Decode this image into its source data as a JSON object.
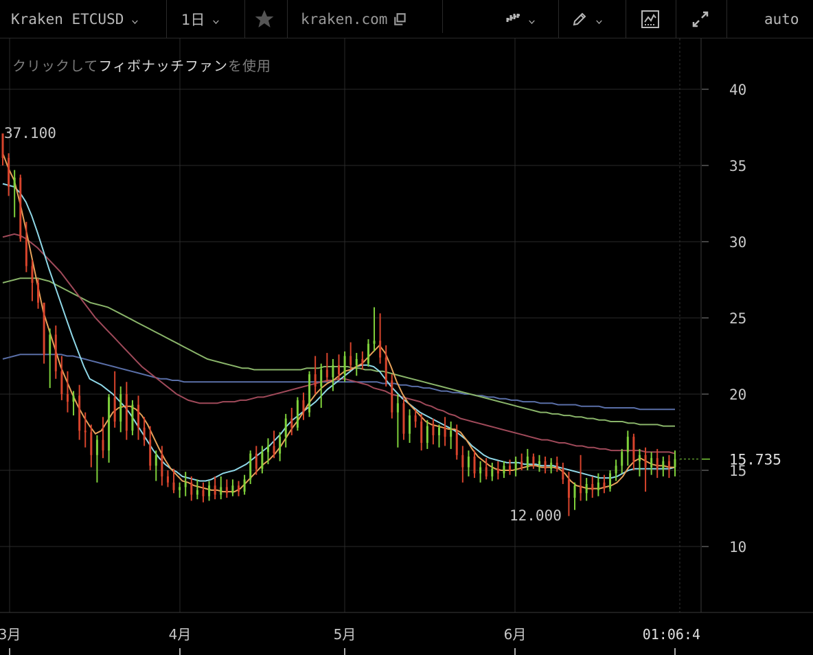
{
  "toolbar": {
    "symbol": "Kraken ETCUSD",
    "interval": "1日",
    "star_icon": "star-icon",
    "domain": "kraken.com",
    "copy_icon": "copy-icon",
    "chart_type_icon": "candlestick-chart-icon",
    "draw_icon": "pencil-icon",
    "indicators_icon": "indicators-icon",
    "fullscreen_icon": "expand-icon",
    "scale_mode": "auto"
  },
  "hint": {
    "prefix": "クリックして",
    "tool": "フィボナッチファン",
    "suffix": "を使用"
  },
  "colors": {
    "up": "#7fd13b",
    "down": "#d8442c",
    "ma_orange": "#e8a25a",
    "ma_cyan": "#8fd8e8",
    "ma_red": "#a04a5a",
    "ma_green": "#8ab56a",
    "ma_blue": "#5a6fa8",
    "grid": "#2a2a2a",
    "axis": "#3a3a3a"
  },
  "chart_data": {
    "type": "candlestick",
    "y_ticks": [
      "40",
      "35",
      "30",
      "25",
      "20",
      "15",
      "10"
    ],
    "ylim": [
      5,
      43
    ],
    "x_ticks": [
      "3月",
      "4月",
      "5月",
      "6月"
    ],
    "last_price": "15.735",
    "high_label": "37.100",
    "low_label": "12.000",
    "time_label": "01:06:4",
    "ohlc": [
      [
        37.1,
        36.2,
        35.0,
        35.5
      ],
      [
        35.5,
        35.8,
        33.0,
        33.6
      ],
      [
        33.6,
        34.7,
        31.6,
        34.2
      ],
      [
        34.2,
        34.4,
        30.0,
        30.2
      ],
      [
        30.2,
        31.3,
        28.0,
        28.4
      ],
      [
        28.4,
        28.8,
        26.1,
        27.3
      ],
      [
        27.3,
        27.6,
        25.6,
        26.0
      ],
      [
        26.0,
        25.8,
        22.0,
        22.6
      ],
      [
        22.6,
        24.3,
        20.4,
        23.9
      ],
      [
        23.9,
        24.5,
        21.0,
        21.5
      ],
      [
        21.5,
        22.5,
        19.6,
        20.0
      ],
      [
        20.0,
        21.5,
        18.8,
        19.5
      ],
      [
        19.5,
        20.2,
        18.6,
        19.9
      ],
      [
        19.9,
        20.6,
        17.0,
        17.6
      ],
      [
        17.6,
        18.8,
        16.5,
        17.5
      ],
      [
        17.5,
        18.0,
        15.2,
        16.0
      ],
      [
        16.0,
        17.3,
        14.2,
        17.0
      ],
      [
        17.0,
        18.5,
        15.8,
        16.3
      ],
      [
        16.3,
        20.0,
        15.5,
        19.8
      ],
      [
        19.8,
        21.5,
        17.8,
        18.2
      ],
      [
        18.2,
        20.5,
        17.5,
        20.0
      ],
      [
        20.0,
        20.8,
        17.0,
        17.6
      ],
      [
        17.6,
        19.6,
        17.3,
        19.3
      ],
      [
        19.3,
        19.9,
        17.0,
        17.8
      ],
      [
        17.8,
        18.5,
        16.6,
        17.0
      ],
      [
        17.0,
        17.9,
        15.0,
        15.3
      ],
      [
        15.3,
        16.3,
        14.3,
        16.0
      ],
      [
        16.0,
        16.6,
        14.0,
        14.6
      ],
      [
        14.6,
        15.0,
        13.9,
        14.2
      ],
      [
        14.2,
        15.1,
        13.5,
        13.7
      ],
      [
        13.7,
        14.2,
        13.2,
        13.9
      ],
      [
        13.9,
        14.9,
        13.3,
        14.2
      ],
      [
        14.2,
        14.6,
        13.0,
        13.4
      ],
      [
        13.4,
        14.4,
        13.1,
        13.7
      ],
      [
        13.7,
        14.2,
        12.9,
        13.3
      ],
      [
        13.3,
        14.3,
        13.0,
        14.0
      ],
      [
        14.0,
        14.6,
        13.1,
        13.4
      ],
      [
        13.4,
        14.6,
        13.1,
        13.9
      ],
      [
        13.9,
        14.4,
        13.2,
        13.5
      ],
      [
        13.5,
        14.4,
        13.3,
        14.0
      ],
      [
        14.0,
        14.3,
        13.3,
        13.6
      ],
      [
        13.6,
        14.7,
        13.4,
        14.4
      ],
      [
        14.4,
        16.3,
        14.1,
        16.1
      ],
      [
        16.1,
        16.6,
        14.7,
        15.1
      ],
      [
        15.1,
        16.6,
        14.8,
        16.2
      ],
      [
        16.2,
        17.1,
        15.4,
        16.6
      ],
      [
        16.6,
        17.6,
        15.8,
        16.1
      ],
      [
        16.1,
        17.5,
        15.6,
        17.2
      ],
      [
        17.2,
        18.7,
        16.5,
        18.4
      ],
      [
        18.4,
        19.1,
        17.3,
        17.8
      ],
      [
        17.8,
        19.8,
        17.6,
        19.6
      ],
      [
        19.6,
        20.1,
        18.3,
        18.8
      ],
      [
        18.8,
        21.5,
        18.5,
        21.3
      ],
      [
        21.3,
        22.5,
        20.0,
        20.5
      ],
      [
        20.5,
        22.0,
        19.1,
        21.6
      ],
      [
        21.6,
        22.7,
        20.8,
        21.1
      ],
      [
        21.1,
        22.3,
        20.2,
        21.9
      ],
      [
        21.9,
        22.6,
        20.9,
        21.3
      ],
      [
        21.3,
        22.8,
        20.8,
        22.5
      ],
      [
        22.5,
        23.4,
        21.6,
        21.9
      ],
      [
        21.9,
        22.7,
        21.2,
        22.3
      ],
      [
        22.3,
        22.8,
        21.6,
        22.0
      ],
      [
        22.0,
        23.6,
        21.8,
        23.3
      ],
      [
        23.3,
        25.7,
        22.8,
        23.5
      ],
      [
        23.5,
        25.3,
        22.0,
        22.4
      ],
      [
        22.4,
        23.2,
        20.5,
        20.9
      ],
      [
        20.9,
        21.3,
        18.4,
        18.8
      ],
      [
        18.8,
        20.0,
        16.5,
        19.4
      ],
      [
        19.4,
        19.7,
        17.0,
        17.4
      ],
      [
        17.4,
        19.0,
        16.8,
        18.6
      ],
      [
        18.6,
        19.0,
        17.8,
        18.2
      ],
      [
        18.2,
        18.7,
        16.3,
        16.8
      ],
      [
        16.8,
        18.3,
        16.4,
        17.9
      ],
      [
        17.9,
        18.4,
        16.7,
        17.3
      ],
      [
        17.3,
        18.0,
        16.5,
        17.8
      ],
      [
        17.8,
        18.5,
        16.6,
        17.2
      ],
      [
        17.2,
        18.2,
        16.4,
        17.6
      ],
      [
        17.6,
        18.0,
        15.7,
        16.0
      ],
      [
        16.0,
        16.6,
        14.2,
        15.2
      ],
      [
        15.2,
        16.3,
        14.6,
        15.9
      ],
      [
        15.9,
        16.3,
        14.5,
        14.8
      ],
      [
        14.8,
        15.6,
        14.2,
        15.2
      ],
      [
        15.2,
        15.8,
        14.4,
        14.6
      ],
      [
        14.6,
        15.5,
        14.3,
        15.1
      ],
      [
        15.1,
        15.6,
        14.4,
        14.8
      ],
      [
        14.8,
        15.6,
        14.5,
        15.3
      ],
      [
        15.3,
        15.7,
        14.7,
        15.0
      ],
      [
        15.0,
        15.9,
        14.6,
        15.6
      ],
      [
        15.6,
        16.1,
        15.0,
        15.2
      ],
      [
        15.2,
        16.4,
        15.0,
        15.9
      ],
      [
        15.9,
        16.1,
        15.1,
        15.4
      ],
      [
        15.4,
        16.0,
        14.9,
        15.6
      ],
      [
        15.6,
        15.9,
        14.8,
        15.1
      ],
      [
        15.1,
        15.8,
        14.8,
        15.5
      ],
      [
        15.5,
        15.9,
        14.9,
        15.1
      ],
      [
        15.1,
        15.5,
        14.1,
        14.4
      ],
      [
        14.4,
        14.9,
        12.0,
        13.2
      ],
      [
        13.2,
        14.2,
        12.4,
        14.0
      ],
      [
        14.0,
        16.0,
        13.0,
        13.5
      ],
      [
        13.5,
        14.5,
        13.0,
        14.1
      ],
      [
        14.1,
        14.6,
        13.2,
        13.7
      ],
      [
        13.7,
        14.8,
        13.3,
        14.2
      ],
      [
        14.2,
        14.7,
        13.5,
        13.8
      ],
      [
        13.8,
        15.0,
        13.6,
        14.8
      ],
      [
        14.8,
        15.7,
        14.3,
        15.3
      ],
      [
        15.3,
        16.4,
        14.8,
        16.2
      ],
      [
        16.2,
        17.6,
        15.3,
        17.2
      ],
      [
        17.2,
        17.4,
        15.0,
        15.6
      ],
      [
        15.6,
        16.4,
        14.6,
        16.0
      ],
      [
        16.0,
        16.5,
        13.6,
        15.2
      ],
      [
        15.2,
        16.2,
        14.7,
        15.8
      ],
      [
        15.8,
        16.4,
        14.5,
        15.1
      ],
      [
        15.1,
        15.9,
        14.6,
        15.6
      ],
      [
        15.6,
        16.0,
        14.5,
        15.2
      ],
      [
        15.2,
        16.3,
        14.6,
        15.735
      ]
    ],
    "ma_short": [
      35.8,
      34.8,
      34.0,
      32.5,
      30.8,
      29.0,
      27.2,
      25.4,
      24.2,
      23.0,
      21.8,
      20.9,
      20.0,
      19.2,
      18.5,
      17.9,
      17.4,
      17.6,
      18.2,
      18.8,
      19.1,
      19.2,
      19.2,
      19.0,
      18.6,
      18.0,
      17.2,
      16.4,
      15.7,
      15.1,
      14.7,
      14.3,
      14.2,
      14.0,
      13.9,
      13.8,
      13.7,
      13.7,
      13.6,
      13.6,
      13.6,
      13.8,
      14.2,
      14.6,
      15.0,
      15.4,
      15.7,
      16.1,
      16.6,
      17.2,
      17.8,
      18.3,
      18.9,
      19.5,
      20.0,
      20.4,
      20.7,
      20.9,
      21.2,
      21.5,
      21.6,
      21.8,
      22.0,
      22.4,
      22.8,
      23.2,
      22.7,
      21.8,
      20.8,
      20.0,
      19.4,
      19.0,
      18.6,
      18.2,
      18.0,
      17.9,
      17.8,
      17.7,
      17.7,
      17.5,
      17.0,
      16.4,
      15.9,
      15.6,
      15.3,
      15.1,
      15.0,
      15.0,
      15.0,
      15.1,
      15.2,
      15.3,
      15.3,
      15.2,
      15.2,
      15.2,
      15.1,
      14.8,
      14.3,
      14.0,
      13.9,
      13.8,
      13.8,
      13.8,
      13.9,
      14.0,
      14.2,
      14.6,
      15.2,
      15.6,
      15.8,
      15.6,
      15.4,
      15.3,
      15.3,
      15.2,
      15.2
    ],
    "ma_cyan": [
      33.8,
      33.7,
      33.6,
      33.2,
      32.6,
      31.7,
      30.6,
      29.4,
      28.2,
      27.1,
      26.0,
      24.9,
      23.8,
      22.8,
      21.8,
      21.0,
      20.8,
      20.6,
      20.3,
      20.0,
      19.6,
      19.2,
      18.7,
      18.1,
      17.5,
      16.9,
      16.3,
      15.8,
      15.4,
      15.1,
      14.9,
      14.6,
      14.5,
      14.4,
      14.3,
      14.3,
      14.4,
      14.6,
      14.8,
      14.9,
      15.0,
      15.2,
      15.4,
      15.7,
      16.0,
      16.3,
      16.6,
      17.0,
      17.4,
      17.9,
      18.3,
      18.6,
      18.9,
      19.2,
      19.5,
      19.9,
      20.3,
      20.6,
      20.9,
      21.2,
      21.5,
      21.8,
      21.9,
      21.9,
      21.8,
      21.5,
      21.0,
      20.5,
      20.1,
      19.7,
      19.4,
      19.1,
      18.8,
      18.6,
      18.4,
      18.2,
      18.0,
      17.8,
      17.6,
      17.3,
      17.0,
      16.6,
      16.3,
      16.0,
      15.8,
      15.7,
      15.6,
      15.5,
      15.5,
      15.5,
      15.4,
      15.4,
      15.4,
      15.3,
      15.3,
      15.3,
      15.2,
      15.1,
      15.0,
      14.9,
      14.8,
      14.7,
      14.6,
      14.5,
      14.5,
      14.5,
      14.6,
      14.8,
      15.0,
      15.1,
      15.1,
      15.1,
      15.1,
      15.1,
      15.1,
      15.1,
      15.2
    ],
    "ma_red": [
      30.3,
      30.4,
      30.5,
      30.4,
      30.2,
      29.9,
      29.6,
      29.2,
      28.8,
      28.4,
      28.0,
      27.5,
      27.0,
      26.5,
      26.0,
      25.5,
      25.0,
      24.6,
      24.2,
      23.8,
      23.4,
      23.0,
      22.6,
      22.2,
      21.8,
      21.5,
      21.2,
      20.9,
      20.6,
      20.3,
      20.0,
      19.8,
      19.6,
      19.5,
      19.4,
      19.4,
      19.4,
      19.4,
      19.5,
      19.5,
      19.5,
      19.6,
      19.6,
      19.7,
      19.8,
      19.8,
      19.9,
      20.0,
      20.1,
      20.2,
      20.3,
      20.4,
      20.5,
      20.6,
      20.7,
      20.8,
      20.9,
      20.9,
      21.0,
      21.0,
      20.9,
      20.8,
      20.7,
      20.6,
      20.4,
      20.3,
      20.2,
      20.0,
      19.9,
      19.8,
      19.7,
      19.6,
      19.5,
      19.3,
      19.2,
      19.0,
      18.9,
      18.7,
      18.6,
      18.4,
      18.3,
      18.2,
      18.1,
      18.0,
      17.9,
      17.8,
      17.7,
      17.6,
      17.5,
      17.4,
      17.3,
      17.2,
      17.1,
      17.0,
      17.0,
      16.9,
      16.8,
      16.8,
      16.7,
      16.6,
      16.6,
      16.5,
      16.5,
      16.4,
      16.4,
      16.3,
      16.3,
      16.3,
      16.3,
      16.3,
      16.3,
      16.2,
      16.2,
      16.2,
      16.2,
      16.2,
      16.1
    ],
    "ma_green": [
      27.3,
      27.4,
      27.5,
      27.6,
      27.6,
      27.6,
      27.6,
      27.5,
      27.4,
      27.2,
      27.0,
      26.8,
      26.6,
      26.4,
      26.2,
      26.0,
      25.9,
      25.8,
      25.7,
      25.5,
      25.3,
      25.1,
      24.9,
      24.7,
      24.5,
      24.3,
      24.1,
      23.9,
      23.7,
      23.5,
      23.3,
      23.1,
      22.9,
      22.7,
      22.5,
      22.3,
      22.2,
      22.1,
      22.0,
      21.9,
      21.8,
      21.7,
      21.7,
      21.6,
      21.6,
      21.6,
      21.6,
      21.6,
      21.6,
      21.6,
      21.6,
      21.6,
      21.7,
      21.7,
      21.7,
      21.8,
      21.8,
      21.8,
      21.8,
      21.8,
      21.7,
      21.7,
      21.6,
      21.6,
      21.5,
      21.5,
      21.4,
      21.3,
      21.2,
      21.1,
      21.0,
      20.9,
      20.8,
      20.7,
      20.6,
      20.5,
      20.4,
      20.3,
      20.2,
      20.1,
      20.0,
      19.9,
      19.8,
      19.7,
      19.6,
      19.5,
      19.4,
      19.3,
      19.2,
      19.1,
      19.0,
      18.9,
      18.8,
      18.8,
      18.7,
      18.7,
      18.6,
      18.6,
      18.5,
      18.5,
      18.4,
      18.4,
      18.3,
      18.3,
      18.2,
      18.2,
      18.2,
      18.1,
      18.1,
      18.0,
      18.0,
      18.0,
      18.0,
      17.9,
      17.9,
      17.9
    ],
    "ma_blue": [
      22.3,
      22.4,
      22.5,
      22.6,
      22.6,
      22.6,
      22.6,
      22.6,
      22.6,
      22.6,
      22.6,
      22.5,
      22.5,
      22.4,
      22.3,
      22.2,
      22.1,
      22.0,
      21.9,
      21.8,
      21.7,
      21.6,
      21.5,
      21.4,
      21.3,
      21.2,
      21.1,
      21.0,
      21.0,
      20.9,
      20.9,
      20.8,
      20.8,
      20.8,
      20.8,
      20.8,
      20.8,
      20.8,
      20.8,
      20.8,
      20.8,
      20.8,
      20.8,
      20.8,
      20.8,
      20.8,
      20.8,
      20.8,
      20.8,
      20.8,
      20.8,
      20.8,
      20.8,
      20.8,
      20.8,
      20.8,
      20.8,
      20.8,
      20.8,
      20.8,
      20.8,
      20.8,
      20.8,
      20.8,
      20.8,
      20.7,
      20.7,
      20.7,
      20.6,
      20.6,
      20.5,
      20.5,
      20.4,
      20.4,
      20.3,
      20.2,
      20.2,
      20.1,
      20.1,
      20.0,
      20.0,
      19.9,
      19.9,
      19.8,
      19.8,
      19.7,
      19.7,
      19.6,
      19.6,
      19.5,
      19.5,
      19.5,
      19.4,
      19.4,
      19.4,
      19.3,
      19.3,
      19.3,
      19.3,
      19.2,
      19.2,
      19.2,
      19.2,
      19.1,
      19.1,
      19.1,
      19.1,
      19.1,
      19.1,
      19.0,
      19.0,
      19.0,
      19.0,
      19.0,
      19.0,
      19.0
    ]
  }
}
